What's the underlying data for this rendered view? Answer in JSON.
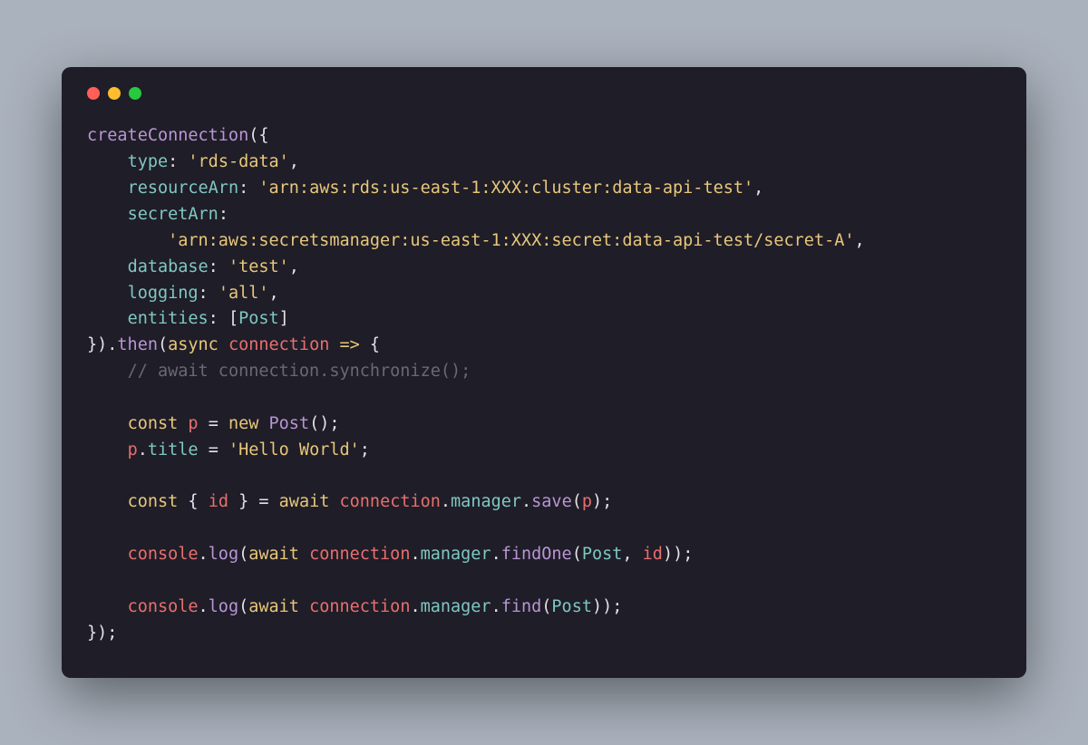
{
  "window": {
    "traffic_lights": [
      "close",
      "minimize",
      "zoom"
    ]
  },
  "code": {
    "fn_createConnection": "createConnection",
    "prop_type": "type",
    "val_type": "'rds-data'",
    "prop_resourceArn": "resourceArn",
    "val_resourceArn": "'arn:aws:rds:us-east-1:XXX:cluster:data-api-test'",
    "prop_secretArn": "secretArn",
    "val_secretArn": "'arn:aws:secretsmanager:us-east-1:XXX:secret:data-api-test/secret-A'",
    "prop_database": "database",
    "val_database": "'test'",
    "prop_logging": "logging",
    "val_logging": "'all'",
    "prop_entities": "entities",
    "val_entities_item": "Post",
    "method_then": "then",
    "kw_async": "async",
    "param_connection": "connection",
    "arrow": "=>",
    "comment_sync": "// await connection.synchronize();",
    "kw_const1": "const",
    "ident_p": "p",
    "op_eq": "=",
    "kw_new": "new",
    "ctor_Post": "Post",
    "ident_p2": "p",
    "prop_title": "title",
    "val_title": "'Hello World'",
    "kw_const2": "const",
    "destr_id": "id",
    "kw_await1": "await",
    "ident_connection1": "connection",
    "prop_manager1": "manager",
    "method_save": "save",
    "arg_p": "p",
    "ident_console1": "console",
    "method_log1": "log",
    "kw_await2": "await",
    "ident_connection2": "connection",
    "prop_manager2": "manager",
    "method_findOne": "findOne",
    "arg_Post1": "Post",
    "arg_id": "id",
    "ident_console2": "console",
    "method_log2": "log",
    "kw_await3": "await",
    "ident_connection3": "connection",
    "prop_manager3": "manager",
    "method_find": "find",
    "arg_Post2": "Post"
  }
}
